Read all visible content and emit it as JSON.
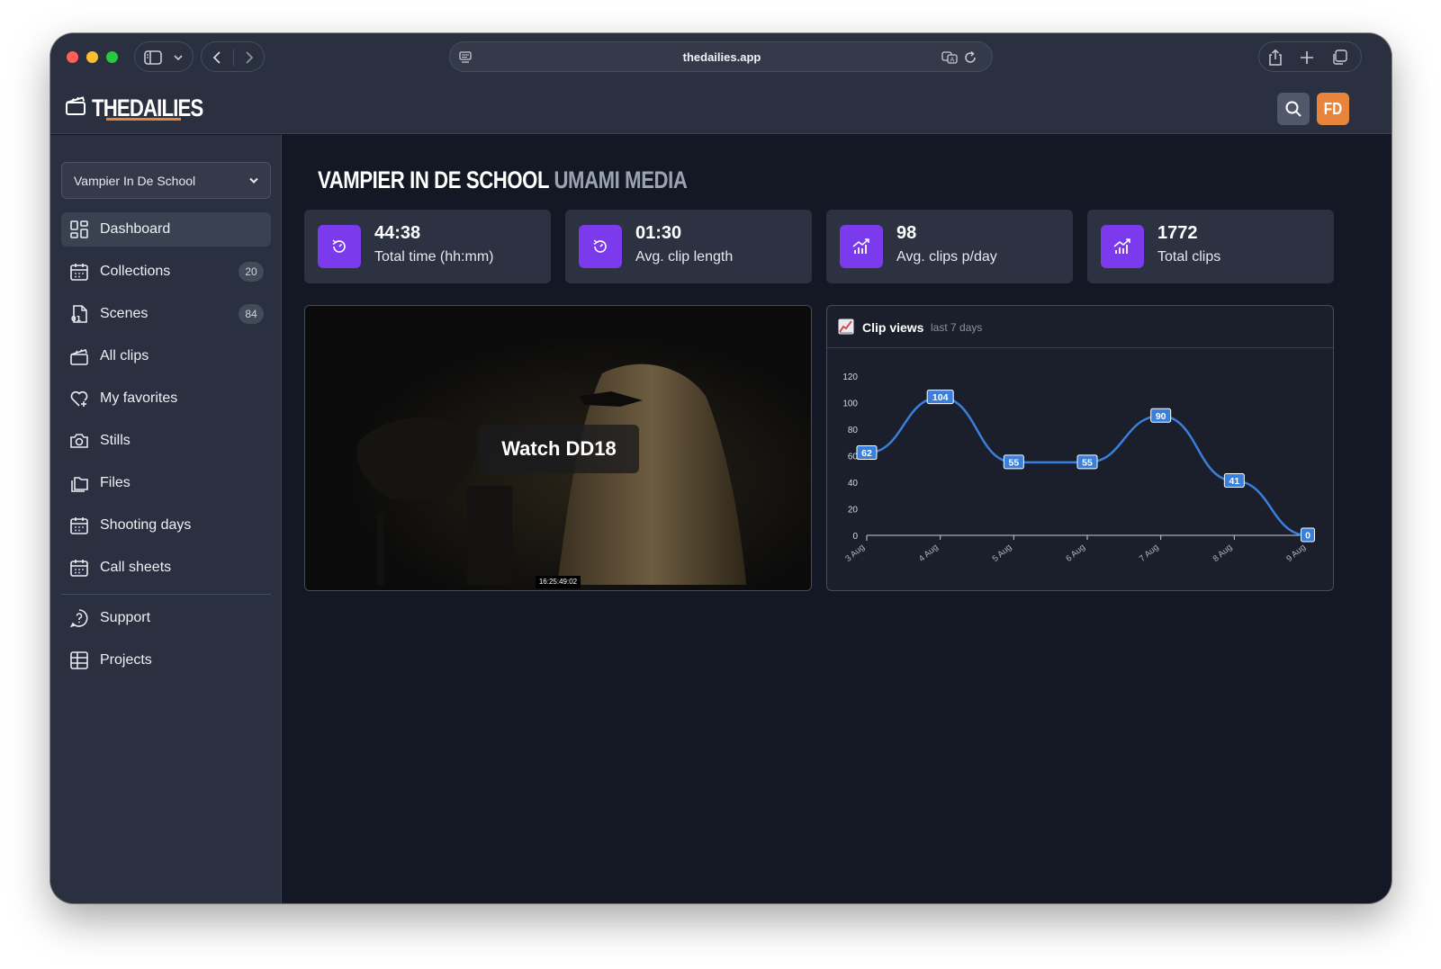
{
  "browser": {
    "url": "thedailies.app"
  },
  "app": {
    "logo": "THEDAILIES",
    "avatar_initials": "FD",
    "accent_orange": "#e8843c",
    "accent_purple": "#7c3aed"
  },
  "sidebar": {
    "project": "Vampier In De School",
    "items": [
      {
        "label": "Dashboard",
        "icon": "dashboard-icon",
        "active": true,
        "badge": ""
      },
      {
        "label": "Collections",
        "icon": "calendar-icon",
        "badge": "20"
      },
      {
        "label": "Scenes",
        "icon": "scene-icon",
        "badge": "84"
      },
      {
        "label": "All clips",
        "icon": "clapperboard-icon",
        "badge": ""
      },
      {
        "label": "My favorites",
        "icon": "heart-icon",
        "badge": ""
      },
      {
        "label": "Stills",
        "icon": "camera-icon",
        "badge": ""
      },
      {
        "label": "Files",
        "icon": "files-icon",
        "badge": ""
      },
      {
        "label": "Shooting days",
        "icon": "calendar-icon",
        "badge": ""
      },
      {
        "label": "Call sheets",
        "icon": "calendar-icon",
        "badge": ""
      }
    ],
    "bottom_items": [
      {
        "label": "Support",
        "icon": "help-icon"
      },
      {
        "label": "Projects",
        "icon": "table-icon"
      }
    ]
  },
  "main": {
    "title_project": "VAMPIER IN DE SCHOOL",
    "title_company": "UMAMI MEDIA",
    "stats": [
      {
        "value": "44:38",
        "label": "Total time (hh:mm)",
        "icon": "timer-icon"
      },
      {
        "value": "01:30",
        "label": "Avg. clip length",
        "icon": "timer-icon"
      },
      {
        "value": "98",
        "label": "Avg. clips p/day",
        "icon": "chart-up-icon"
      },
      {
        "value": "1772",
        "label": "Total clips",
        "icon": "chart-up-icon"
      }
    ],
    "video": {
      "button_label": "Watch DD18",
      "timecode": "16:25:49:02"
    }
  },
  "chart_data": {
    "type": "line",
    "title": "Clip views",
    "subtitle": "last 7 days",
    "categories": [
      "3 Aug",
      "4 Aug",
      "5 Aug",
      "6 Aug",
      "7 Aug",
      "8 Aug",
      "9 Aug"
    ],
    "values": [
      62,
      104,
      55,
      55,
      90,
      41,
      0
    ],
    "ylim": [
      0,
      120
    ],
    "yticks": [
      0,
      20,
      40,
      60,
      80,
      100,
      120
    ],
    "line_color": "#3b7fdc",
    "grid": false
  }
}
